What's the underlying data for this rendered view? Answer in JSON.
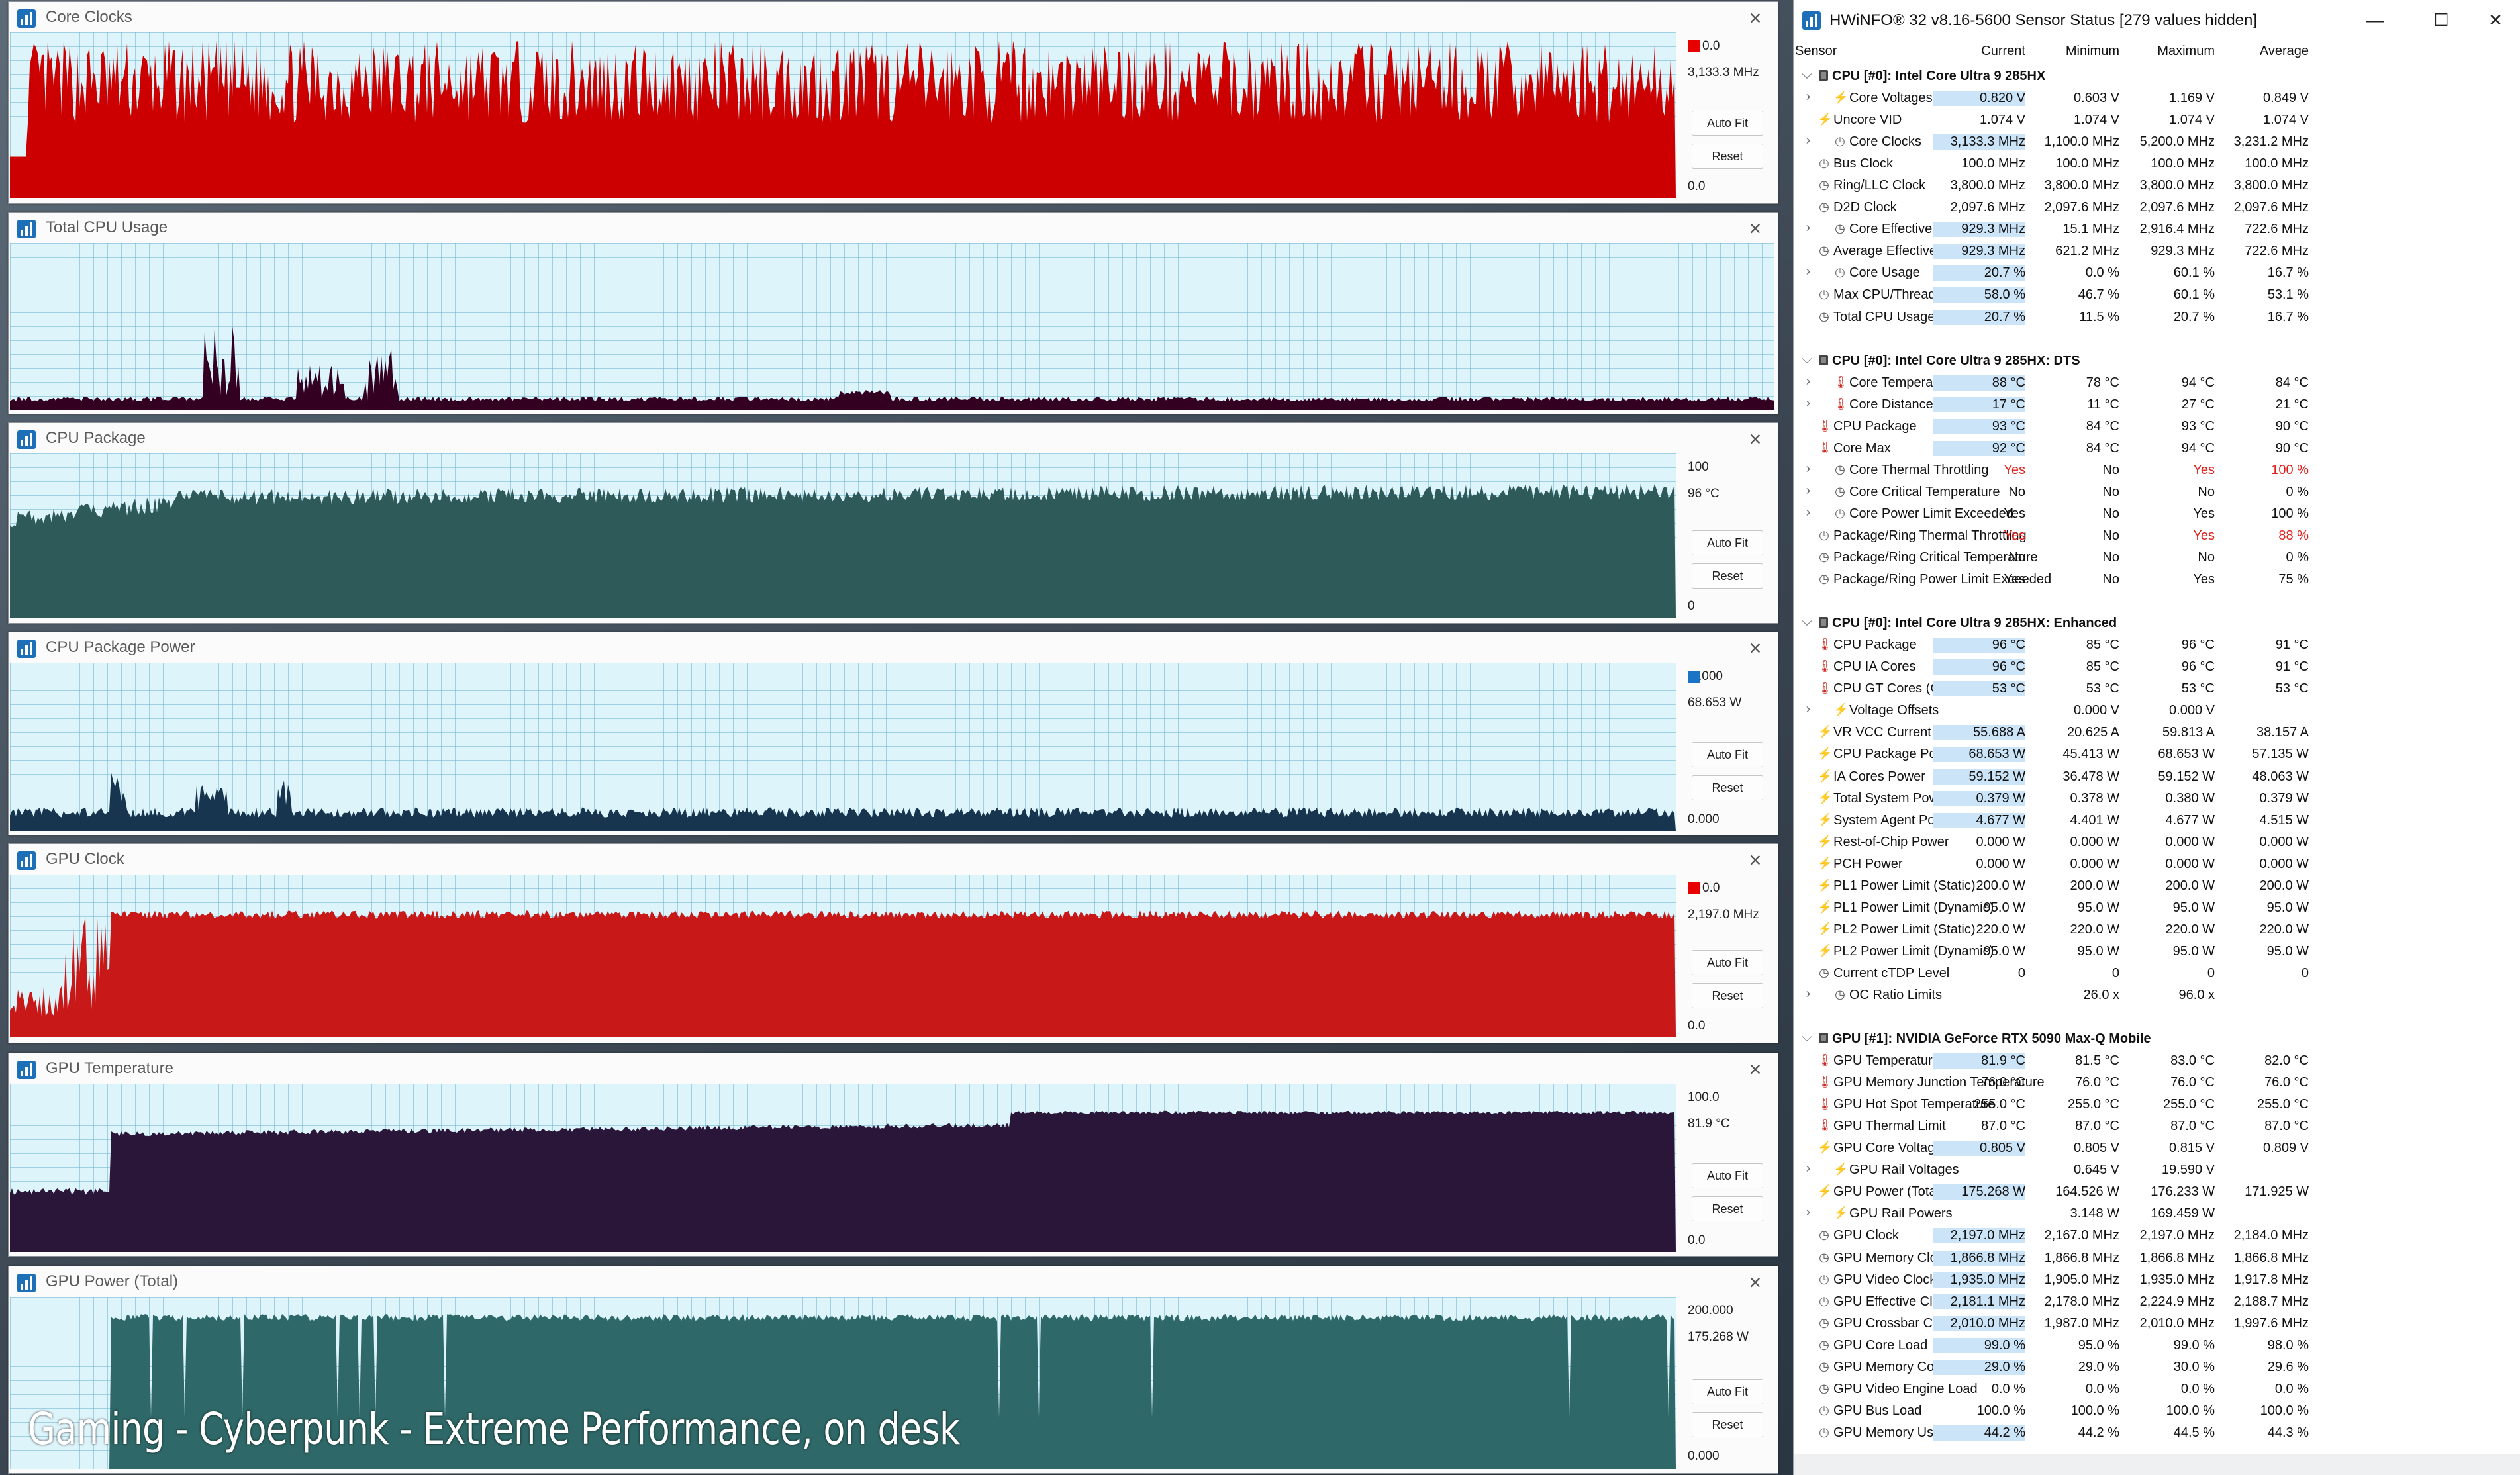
{
  "graphs": [
    {
      "title": "Core Clocks",
      "max": "0.0",
      "current": "3,133.3 MHz",
      "min": "0.0",
      "color": "#cc0000",
      "swatch": "#e60000",
      "buttons": [
        "Auto Fit",
        "Reset"
      ]
    },
    {
      "title": "Total CPU Usage",
      "color": "#330022"
    },
    {
      "title": "CPU Package",
      "max": "100",
      "current": "96 °C",
      "min": "0",
      "color": "#2e5a5a",
      "buttons": [
        "Auto Fit",
        "Reset"
      ]
    },
    {
      "title": "CPU Package Power",
      "max": ".000",
      "current": "68.653 W",
      "min": "0.000",
      "color": "#17354f",
      "swatch": "#1a73c4",
      "buttons": [
        "Auto Fit",
        "Reset"
      ]
    },
    {
      "title": "GPU Clock",
      "max": "0.0",
      "current": "2,197.0 MHz",
      "min": "0.0",
      "color": "#c81818",
      "swatch": "#e60000",
      "buttons": [
        "Auto Fit",
        "Reset"
      ]
    },
    {
      "title": "GPU Temperature",
      "max": "100.0",
      "current": "81.9 °C",
      "min": "0.0",
      "color": "#2a1638",
      "buttons": [
        "Auto Fit",
        "Reset"
      ]
    },
    {
      "title": "GPU Power (Total)",
      "max": "200.000",
      "current": "175.268 W",
      "min": "0.000",
      "color": "#2f6868",
      "buttons": [
        "Auto Fit",
        "Reset"
      ]
    }
  ],
  "caption": "Gaming - Cyberpunk - Extreme Performance, on desk",
  "sensor": {
    "title": "HWiNFO® 32 v8.16-5600 Sensor Status [279 values hidden]",
    "window_buttons": [
      "—",
      "☐",
      "✕"
    ],
    "columns": [
      "Sensor",
      "Current",
      "Minimum",
      "Maximum",
      "Average"
    ],
    "rows": [
      {
        "t": "g",
        "l": "CPU [#0]: Intel Core Ultra 9 285HX"
      },
      {
        "x": 1,
        "i": "bolt",
        "l": "Core Voltages",
        "v": [
          "0.820 V",
          "0.603 V",
          "1.169 V",
          "0.849 V"
        ],
        "h": 1
      },
      {
        "i": "bolt",
        "l": "Uncore VID",
        "v": [
          "1.074 V",
          "1.074 V",
          "1.074 V",
          "1.074 V"
        ]
      },
      {
        "x": 1,
        "i": "clock",
        "l": "Core Clocks",
        "v": [
          "3,133.3 MHz",
          "1,100.0 MHz",
          "5,200.0 MHz",
          "3,231.2 MHz"
        ],
        "h": 1
      },
      {
        "i": "clock",
        "l": "Bus Clock",
        "v": [
          "100.0 MHz",
          "100.0 MHz",
          "100.0 MHz",
          "100.0 MHz"
        ]
      },
      {
        "i": "clock",
        "l": "Ring/LLC Clock",
        "v": [
          "3,800.0 MHz",
          "3,800.0 MHz",
          "3,800.0 MHz",
          "3,800.0 MHz"
        ]
      },
      {
        "i": "clock",
        "l": "D2D Clock",
        "v": [
          "2,097.6 MHz",
          "2,097.6 MHz",
          "2,097.6 MHz",
          "2,097.6 MHz"
        ]
      },
      {
        "x": 1,
        "i": "clock",
        "l": "Core Effective Clocks",
        "v": [
          "929.3 MHz",
          "15.1 MHz",
          "2,916.4 MHz",
          "722.6 MHz"
        ],
        "h": 1
      },
      {
        "i": "clock",
        "l": "Average Effective Clock",
        "v": [
          "929.3 MHz",
          "621.2 MHz",
          "929.3 MHz",
          "722.6 MHz"
        ],
        "h": 1
      },
      {
        "x": 1,
        "i": "clock",
        "l": "Core Usage",
        "v": [
          "20.7 %",
          "0.0 %",
          "60.1 %",
          "16.7 %"
        ],
        "h": 1
      },
      {
        "i": "clock",
        "l": "Max CPU/Thread Usage",
        "v": [
          "58.0 %",
          "46.7 %",
          "60.1 %",
          "53.1 %"
        ],
        "h": 1
      },
      {
        "i": "clock",
        "l": "Total CPU Usage",
        "v": [
          "20.7 %",
          "11.5 %",
          "20.7 %",
          "16.7 %"
        ],
        "h": 1
      },
      {
        "t": "s"
      },
      {
        "t": "g",
        "l": "CPU [#0]: Intel Core Ultra 9 285HX: DTS"
      },
      {
        "x": 1,
        "i": "therm",
        "l": "Core Temperatures",
        "v": [
          "88 °C",
          "78 °C",
          "94 °C",
          "84 °C"
        ],
        "h": 1
      },
      {
        "x": 1,
        "i": "therm",
        "l": "Core Distance to TjMAX",
        "v": [
          "17 °C",
          "11 °C",
          "27 °C",
          "21 °C"
        ],
        "h": 1
      },
      {
        "i": "therm",
        "l": "CPU Package",
        "v": [
          "93 °C",
          "84 °C",
          "93 °C",
          "90 °C"
        ],
        "h": 1
      },
      {
        "i": "therm",
        "l": "Core Max",
        "v": [
          "92 °C",
          "84 °C",
          "94 °C",
          "90 °C"
        ],
        "h": 1
      },
      {
        "x": 1,
        "i": "clock",
        "l": "Core Thermal Throttling",
        "v": [
          "Yes",
          "No",
          "Yes",
          "100 %"
        ],
        "r": [
          1,
          0,
          1,
          1
        ]
      },
      {
        "x": 1,
        "i": "clock",
        "l": "Core Critical Temperature",
        "v": [
          "No",
          "No",
          "No",
          "0 %"
        ]
      },
      {
        "x": 1,
        "i": "clock",
        "l": "Core Power Limit Exceeded",
        "v": [
          "Yes",
          "No",
          "Yes",
          "100 %"
        ]
      },
      {
        "i": "clock",
        "l": "Package/Ring Thermal Throttling",
        "v": [
          "Yes",
          "No",
          "Yes",
          "88 %"
        ],
        "r": [
          1,
          0,
          1,
          1
        ]
      },
      {
        "i": "clock",
        "l": "Package/Ring Critical Temperature",
        "v": [
          "No",
          "No",
          "No",
          "0 %"
        ]
      },
      {
        "i": "clock",
        "l": "Package/Ring Power Limit Exceeded",
        "v": [
          "Yes",
          "No",
          "Yes",
          "75 %"
        ]
      },
      {
        "t": "s"
      },
      {
        "t": "g",
        "l": "CPU [#0]: Intel Core Ultra 9 285HX: Enhanced"
      },
      {
        "i": "therm",
        "l": "CPU Package",
        "v": [
          "96 °C",
          "85 °C",
          "96 °C",
          "91 °C"
        ],
        "h": 1
      },
      {
        "i": "therm",
        "l": "CPU IA Cores",
        "v": [
          "96 °C",
          "85 °C",
          "96 °C",
          "91 °C"
        ],
        "h": 1
      },
      {
        "i": "therm",
        "l": "CPU GT Cores (Graphics)",
        "v": [
          "53 °C",
          "53 °C",
          "53 °C",
          "53 °C"
        ],
        "h": 1
      },
      {
        "x": 1,
        "i": "bolt",
        "l": "Voltage Offsets",
        "v": [
          "",
          "0.000 V",
          "0.000 V",
          ""
        ]
      },
      {
        "i": "bolt",
        "l": "VR VCC Current (SVID IOUT)",
        "v": [
          "55.688 A",
          "20.625 A",
          "59.813 A",
          "38.157 A"
        ],
        "h": 1
      },
      {
        "i": "bolt",
        "l": "CPU Package Power",
        "v": [
          "68.653 W",
          "45.413 W",
          "68.653 W",
          "57.135 W"
        ],
        "h": 1
      },
      {
        "i": "bolt",
        "l": "IA Cores Power",
        "v": [
          "59.152 W",
          "36.478 W",
          "59.152 W",
          "48.063 W"
        ],
        "h": 1
      },
      {
        "i": "bolt",
        "l": "Total System Power",
        "v": [
          "0.379 W",
          "0.378 W",
          "0.380 W",
          "0.379 W"
        ],
        "h": 1
      },
      {
        "i": "bolt",
        "l": "System Agent Power",
        "v": [
          "4.677 W",
          "4.401 W",
          "4.677 W",
          "4.515 W"
        ],
        "h": 1
      },
      {
        "i": "bolt",
        "l": "Rest-of-Chip Power",
        "v": [
          "0.000 W",
          "0.000 W",
          "0.000 W",
          "0.000 W"
        ]
      },
      {
        "i": "bolt",
        "l": "PCH Power",
        "v": [
          "0.000 W",
          "0.000 W",
          "0.000 W",
          "0.000 W"
        ]
      },
      {
        "i": "bolt",
        "l": "PL1 Power Limit (Static)",
        "v": [
          "200.0 W",
          "200.0 W",
          "200.0 W",
          "200.0 W"
        ]
      },
      {
        "i": "bolt",
        "l": "PL1 Power Limit (Dynamic)",
        "v": [
          "95.0 W",
          "95.0 W",
          "95.0 W",
          "95.0 W"
        ]
      },
      {
        "i": "bolt",
        "l": "PL2 Power Limit (Static)",
        "v": [
          "220.0 W",
          "220.0 W",
          "220.0 W",
          "220.0 W"
        ]
      },
      {
        "i": "bolt",
        "l": "PL2 Power Limit (Dynamic)",
        "v": [
          "95.0 W",
          "95.0 W",
          "95.0 W",
          "95.0 W"
        ]
      },
      {
        "i": "clock",
        "l": "Current cTDP Level",
        "v": [
          "0",
          "0",
          "0",
          "0"
        ]
      },
      {
        "x": 1,
        "i": "clock",
        "l": "OC Ratio Limits",
        "v": [
          "",
          "26.0 x",
          "96.0 x",
          ""
        ]
      },
      {
        "t": "s"
      },
      {
        "t": "g",
        "l": "GPU [#1]: NVIDIA  GeForce RTX 5090 Max-Q Mobile"
      },
      {
        "i": "therm",
        "l": "GPU Temperature",
        "v": [
          "81.9 °C",
          "81.5 °C",
          "83.0 °C",
          "82.0 °C"
        ],
        "h": 1
      },
      {
        "i": "therm",
        "l": "GPU Memory Junction Temperature",
        "v": [
          "76.0 °C",
          "76.0 °C",
          "76.0 °C",
          "76.0 °C"
        ]
      },
      {
        "i": "therm",
        "l": "GPU Hot Spot Temperature",
        "v": [
          "255.0 °C",
          "255.0 °C",
          "255.0 °C",
          "255.0 °C"
        ]
      },
      {
        "i": "therm",
        "l": "GPU Thermal Limit",
        "v": [
          "87.0 °C",
          "87.0 °C",
          "87.0 °C",
          "87.0 °C"
        ]
      },
      {
        "i": "bolt",
        "l": "GPU Core Voltage",
        "v": [
          "0.805 V",
          "0.805 V",
          "0.815 V",
          "0.809 V"
        ],
        "h": 1
      },
      {
        "x": 1,
        "i": "bolt",
        "l": "GPU Rail Voltages",
        "v": [
          "",
          "0.645 V",
          "19.590 V",
          ""
        ]
      },
      {
        "i": "bolt",
        "l": "GPU Power (Total)",
        "v": [
          "175.268 W",
          "164.526 W",
          "176.233 W",
          "171.925 W"
        ],
        "h": 1
      },
      {
        "x": 1,
        "i": "bolt",
        "l": "GPU Rail Powers",
        "v": [
          "",
          "3.148 W",
          "169.459 W",
          ""
        ]
      },
      {
        "i": "clock",
        "l": "GPU Clock",
        "v": [
          "2,197.0 MHz",
          "2,167.0 MHz",
          "2,197.0 MHz",
          "2,184.0 MHz"
        ],
        "h": 1
      },
      {
        "i": "clock",
        "l": "GPU Memory Clock",
        "v": [
          "1,866.8 MHz",
          "1,866.8 MHz",
          "1,866.8 MHz",
          "1,866.8 MHz"
        ],
        "h": 1
      },
      {
        "i": "clock",
        "l": "GPU Video Clock",
        "v": [
          "1,935.0 MHz",
          "1,905.0 MHz",
          "1,935.0 MHz",
          "1,917.8 MHz"
        ],
        "h": 1
      },
      {
        "i": "clock",
        "l": "GPU Effective Clock",
        "v": [
          "2,181.1 MHz",
          "2,178.0 MHz",
          "2,224.9 MHz",
          "2,188.7 MHz"
        ],
        "h": 1
      },
      {
        "i": "clock",
        "l": "GPU Crossbar Clock",
        "v": [
          "2,010.0 MHz",
          "1,987.0 MHz",
          "2,010.0 MHz",
          "1,997.6 MHz"
        ],
        "h": 1
      },
      {
        "i": "clock",
        "l": "GPU Core Load",
        "v": [
          "99.0 %",
          "95.0 %",
          "99.0 %",
          "98.0 %"
        ],
        "h": 1
      },
      {
        "i": "clock",
        "l": "GPU Memory Controller Load",
        "v": [
          "29.0 %",
          "29.0 %",
          "30.0 %",
          "29.6 %"
        ],
        "h": 1
      },
      {
        "i": "clock",
        "l": "GPU Video Engine Load",
        "v": [
          "0.0 %",
          "0.0 %",
          "0.0 %",
          "0.0 %"
        ]
      },
      {
        "i": "clock",
        "l": "GPU Bus Load",
        "v": [
          "100.0 %",
          "100.0 %",
          "100.0 %",
          "100.0 %"
        ]
      },
      {
        "i": "clock",
        "l": "GPU Memory Usage",
        "v": [
          "44.2 %",
          "44.2 %",
          "44.5 %",
          "44.3 %"
        ],
        "h": 1
      }
    ]
  }
}
